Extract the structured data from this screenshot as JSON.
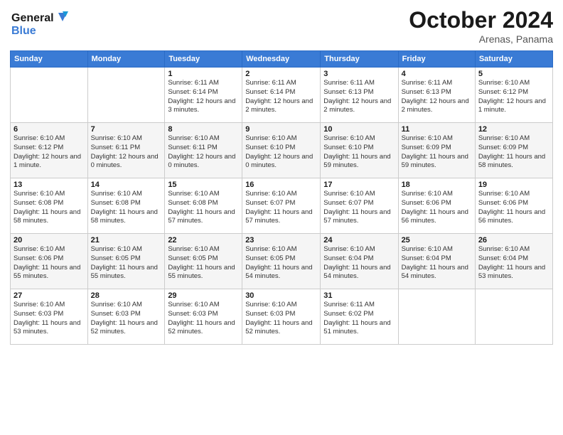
{
  "logo": {
    "line1": "General",
    "line2": "Blue"
  },
  "title": "October 2024",
  "subtitle": "Arenas, Panama",
  "header_days": [
    "Sunday",
    "Monday",
    "Tuesday",
    "Wednesday",
    "Thursday",
    "Friday",
    "Saturday"
  ],
  "weeks": [
    [
      {
        "day": "",
        "info": ""
      },
      {
        "day": "",
        "info": ""
      },
      {
        "day": "1",
        "info": "Sunrise: 6:11 AM\nSunset: 6:14 PM\nDaylight: 12 hours and 3 minutes."
      },
      {
        "day": "2",
        "info": "Sunrise: 6:11 AM\nSunset: 6:14 PM\nDaylight: 12 hours and 2 minutes."
      },
      {
        "day": "3",
        "info": "Sunrise: 6:11 AM\nSunset: 6:13 PM\nDaylight: 12 hours and 2 minutes."
      },
      {
        "day": "4",
        "info": "Sunrise: 6:11 AM\nSunset: 6:13 PM\nDaylight: 12 hours and 2 minutes."
      },
      {
        "day": "5",
        "info": "Sunrise: 6:10 AM\nSunset: 6:12 PM\nDaylight: 12 hours and 1 minute."
      }
    ],
    [
      {
        "day": "6",
        "info": "Sunrise: 6:10 AM\nSunset: 6:12 PM\nDaylight: 12 hours and 1 minute."
      },
      {
        "day": "7",
        "info": "Sunrise: 6:10 AM\nSunset: 6:11 PM\nDaylight: 12 hours and 0 minutes."
      },
      {
        "day": "8",
        "info": "Sunrise: 6:10 AM\nSunset: 6:11 PM\nDaylight: 12 hours and 0 minutes."
      },
      {
        "day": "9",
        "info": "Sunrise: 6:10 AM\nSunset: 6:10 PM\nDaylight: 12 hours and 0 minutes."
      },
      {
        "day": "10",
        "info": "Sunrise: 6:10 AM\nSunset: 6:10 PM\nDaylight: 11 hours and 59 minutes."
      },
      {
        "day": "11",
        "info": "Sunrise: 6:10 AM\nSunset: 6:09 PM\nDaylight: 11 hours and 59 minutes."
      },
      {
        "day": "12",
        "info": "Sunrise: 6:10 AM\nSunset: 6:09 PM\nDaylight: 11 hours and 58 minutes."
      }
    ],
    [
      {
        "day": "13",
        "info": "Sunrise: 6:10 AM\nSunset: 6:08 PM\nDaylight: 11 hours and 58 minutes."
      },
      {
        "day": "14",
        "info": "Sunrise: 6:10 AM\nSunset: 6:08 PM\nDaylight: 11 hours and 58 minutes."
      },
      {
        "day": "15",
        "info": "Sunrise: 6:10 AM\nSunset: 6:08 PM\nDaylight: 11 hours and 57 minutes."
      },
      {
        "day": "16",
        "info": "Sunrise: 6:10 AM\nSunset: 6:07 PM\nDaylight: 11 hours and 57 minutes."
      },
      {
        "day": "17",
        "info": "Sunrise: 6:10 AM\nSunset: 6:07 PM\nDaylight: 11 hours and 57 minutes."
      },
      {
        "day": "18",
        "info": "Sunrise: 6:10 AM\nSunset: 6:06 PM\nDaylight: 11 hours and 56 minutes."
      },
      {
        "day": "19",
        "info": "Sunrise: 6:10 AM\nSunset: 6:06 PM\nDaylight: 11 hours and 56 minutes."
      }
    ],
    [
      {
        "day": "20",
        "info": "Sunrise: 6:10 AM\nSunset: 6:06 PM\nDaylight: 11 hours and 55 minutes."
      },
      {
        "day": "21",
        "info": "Sunrise: 6:10 AM\nSunset: 6:05 PM\nDaylight: 11 hours and 55 minutes."
      },
      {
        "day": "22",
        "info": "Sunrise: 6:10 AM\nSunset: 6:05 PM\nDaylight: 11 hours and 55 minutes."
      },
      {
        "day": "23",
        "info": "Sunrise: 6:10 AM\nSunset: 6:05 PM\nDaylight: 11 hours and 54 minutes."
      },
      {
        "day": "24",
        "info": "Sunrise: 6:10 AM\nSunset: 6:04 PM\nDaylight: 11 hours and 54 minutes."
      },
      {
        "day": "25",
        "info": "Sunrise: 6:10 AM\nSunset: 6:04 PM\nDaylight: 11 hours and 54 minutes."
      },
      {
        "day": "26",
        "info": "Sunrise: 6:10 AM\nSunset: 6:04 PM\nDaylight: 11 hours and 53 minutes."
      }
    ],
    [
      {
        "day": "27",
        "info": "Sunrise: 6:10 AM\nSunset: 6:03 PM\nDaylight: 11 hours and 53 minutes."
      },
      {
        "day": "28",
        "info": "Sunrise: 6:10 AM\nSunset: 6:03 PM\nDaylight: 11 hours and 52 minutes."
      },
      {
        "day": "29",
        "info": "Sunrise: 6:10 AM\nSunset: 6:03 PM\nDaylight: 11 hours and 52 minutes."
      },
      {
        "day": "30",
        "info": "Sunrise: 6:10 AM\nSunset: 6:03 PM\nDaylight: 11 hours and 52 minutes."
      },
      {
        "day": "31",
        "info": "Sunrise: 6:11 AM\nSunset: 6:02 PM\nDaylight: 11 hours and 51 minutes."
      },
      {
        "day": "",
        "info": ""
      },
      {
        "day": "",
        "info": ""
      }
    ]
  ]
}
